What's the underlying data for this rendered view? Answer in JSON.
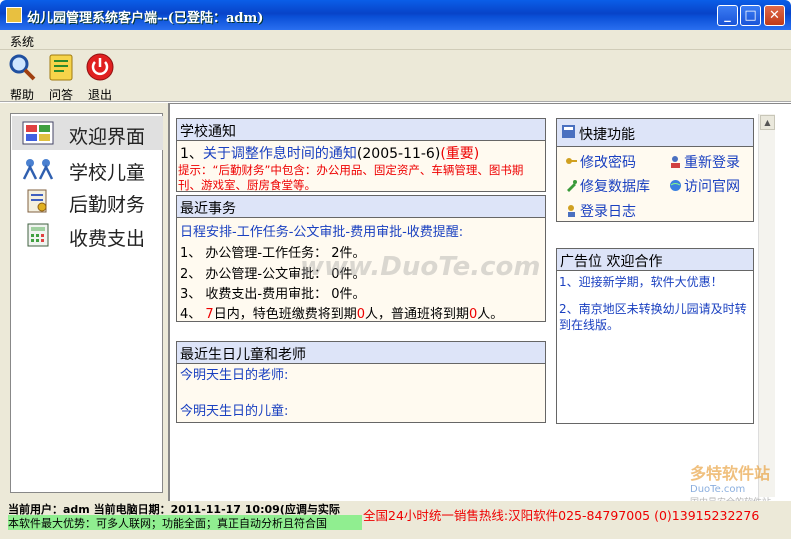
{
  "window": {
    "title": "幼儿园管理系统客户端--(已登陆：adm)",
    "minimize": "_",
    "maximize": "□",
    "close": "✕"
  },
  "menu": {
    "items": [
      "系统"
    ]
  },
  "toolbar": {
    "help": "帮助",
    "qa": "问答",
    "exit": "退出"
  },
  "nav": {
    "items": [
      {
        "label": "欢迎界面",
        "icon": "dashboard-icon",
        "active": true
      },
      {
        "label": "学校儿童",
        "icon": "children-icon",
        "active": false
      },
      {
        "label": "后勤财务",
        "icon": "finance-icon",
        "active": false
      },
      {
        "label": "收费支出",
        "icon": "calculator-icon",
        "active": false
      }
    ]
  },
  "notice": {
    "header": "学校通知",
    "item_prefix": "1、",
    "item_link": "关于调整作息时间的通知",
    "item_date": "(2005-11-6)",
    "item_tag": "(重要)",
    "tip": "提示：“后勤财务”中包含：办公用品、固定资产、车辆管理、图书期刊、游戏室、厨房食堂等。"
  },
  "recent": {
    "header": "最近事务",
    "summary": "日程安排-工作任务-公文审批-费用审批-收费提醒:",
    "line1": "1、 办公管理-工作任务： 2件。",
    "line2": "2、 办公管理-公文审批： 0件。",
    "line3": "3、 收费支出-费用审批： 0件。",
    "line4_a": "4、 ",
    "line4_days": "7",
    "line4_b": "日内，特色班缴费将到期",
    "line4_n1": "0",
    "line4_c": "人，普通班将到期",
    "line4_n2": "0",
    "line4_d": "人。"
  },
  "birthday": {
    "header": "最近生日儿童和老师",
    "teachers": "今明天生日的老师:",
    "children": "今明天生日的儿童:"
  },
  "quick": {
    "header": "快捷功能",
    "change_password": "修改密码",
    "relogin": "重新登录",
    "repair_db": "修复数据库",
    "visit_site": "访问官网",
    "login_log": "登录日志"
  },
  "ad": {
    "header": "广告位  欢迎合作",
    "line1": "1、迎接新学期，软件大优惠！",
    "line2": "2、南京地区未转换幼儿园请及时转到在线版。"
  },
  "status": {
    "user_info": "当前用户：adm  当前电脑日期：2011-11-17  10:09(应调与实际",
    "advantage": "本软件最大优势：可多人联网；功能全面；真正自动分析且符合国",
    "hotline": "全国24小时统一销售热线:汉阳软件025-84797005  (0)13915232276"
  },
  "watermark": "www.DuoTe.com",
  "watermark_corner": {
    "brand": "多特软件站",
    "site": "DuoTe.com",
    "tagline": "国内最安全的软件站"
  }
}
